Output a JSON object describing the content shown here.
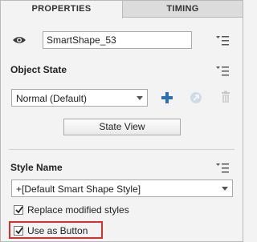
{
  "tabs": {
    "properties": "PROPERTIES",
    "timing": "TIMING"
  },
  "object": {
    "name_value": "SmartShape_53"
  },
  "object_state": {
    "title": "Object State",
    "state_value": "Normal (Default)",
    "state_view_label": "State View"
  },
  "style": {
    "title": "Style Name",
    "style_value": "+[Default Smart Shape Style]",
    "replace_label": "Replace modified styles",
    "use_as_button_label": "Use as Button",
    "replace_checked": true,
    "use_as_button_checked": true
  },
  "icons": {
    "visibility": "eye-icon",
    "menu": "panel-menu-icon",
    "add_state": "plus-icon",
    "edit_state": "edit-state-icon",
    "delete_state": "trash-icon"
  },
  "colors": {
    "accent_blue": "#2b6fb6",
    "highlight_red": "#d9302c"
  }
}
